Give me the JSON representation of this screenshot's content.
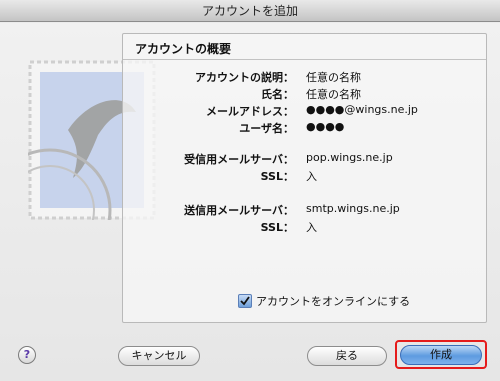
{
  "window": {
    "title": "アカウントを追加"
  },
  "panel": {
    "title": "アカウントの概要",
    "fields": [
      {
        "label": "アカウントの説明：",
        "value": "任意の名称"
      },
      {
        "label": "氏名：",
        "value": "任意の名称"
      },
      {
        "label": "メールアドレス：",
        "value": "●●●●@wings.ne.jp"
      },
      {
        "label": "ユーザ名：",
        "value": "●●●●"
      },
      {
        "label": "受信用メールサーバ：",
        "value": "pop.wings.ne.jp"
      },
      {
        "label": "SSL：",
        "value": "入"
      },
      {
        "label": "送信用メールサーバ：",
        "value": "smtp.wings.ne.jp"
      },
      {
        "label": "SSL：",
        "value": "入"
      }
    ],
    "online_checkbox": {
      "label": "アカウントをオンラインにする",
      "checked": true
    }
  },
  "buttons": {
    "help": "?",
    "cancel": "キャンセル",
    "back": "戻る",
    "create": "作成"
  },
  "colors": {
    "highlight": "#e51b1b",
    "default_button": "#5e9be0"
  }
}
